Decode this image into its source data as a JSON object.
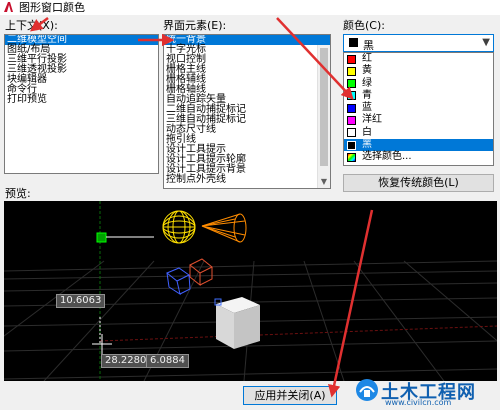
{
  "window": {
    "title": "图形窗口颜色"
  },
  "context": {
    "label": "上下文(X):",
    "items": [
      "二维模型空间",
      "图纸/布局",
      "三维平行投影",
      "三维透视投影",
      "块编辑器",
      "命令行",
      "打印预览"
    ],
    "selected_index": 0
  },
  "elements": {
    "label": "界面元素(E):",
    "items": [
      "统一背景",
      "十字光标",
      "视口控制",
      "栅格主线",
      "栅格辅线",
      "栅格轴线",
      "自动追踪矢量",
      "二维自动捕捉标记",
      "三维自动捕捉标记",
      "动态尺寸线",
      "拖引线",
      "设计工具提示",
      "设计工具提示轮廓",
      "设计工具提示背景",
      "控制点外壳线"
    ],
    "selected_index": 0
  },
  "color": {
    "label": "颜色(C):",
    "selected_label": "黑",
    "selected_color": "#000000",
    "options": [
      {
        "label": "红",
        "color": "#ff0000"
      },
      {
        "label": "黄",
        "color": "#ffff00"
      },
      {
        "label": "绿",
        "color": "#00ff00"
      },
      {
        "label": "青",
        "color": "#00ffff"
      },
      {
        "label": "蓝",
        "color": "#0000ff"
      },
      {
        "label": "洋红",
        "color": "#ff00ff"
      },
      {
        "label": "白",
        "color": "#ffffff"
      },
      {
        "label": "黑",
        "color": "#000000"
      },
      {
        "label": "选择颜色...",
        "color": "multi"
      }
    ],
    "highlighted_index": 7
  },
  "restore_button": "恢复传统颜色(L)",
  "preview": {
    "label": "预览:",
    "coord1": "10.6063",
    "coord2": "28.2280",
    "coord3": "6.0884"
  },
  "apply_button": "应用并关闭(A)",
  "watermark": {
    "title": "土木工程网",
    "url": "www.civilcn.com"
  },
  "accent_color": "#0078d7",
  "annotation_color": "#e03030"
}
